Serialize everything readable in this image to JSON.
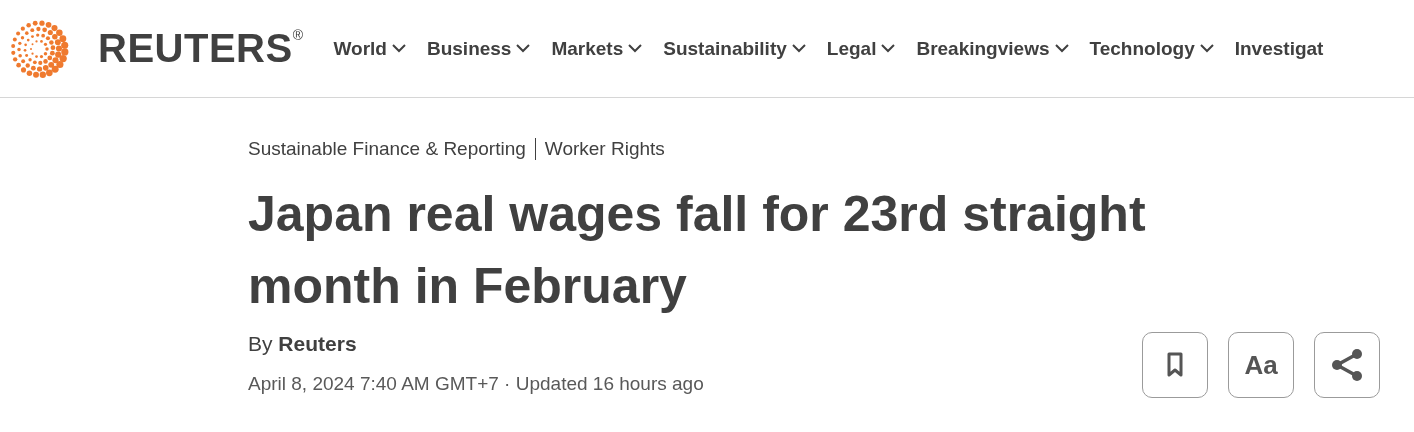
{
  "header": {
    "logo": "REUTERS$^{®}$",
    "nav": [
      {
        "label": "World",
        "has_menu": true
      },
      {
        "label": "Business",
        "has_menu": true
      },
      {
        "label": "Markets",
        "has_menu": true
      },
      {
        "label": "Sustainability",
        "has_menu": true
      },
      {
        "label": "Legal",
        "has_menu": true
      },
      {
        "label": "Breakingviews",
        "has_menu": true
      },
      {
        "label": "Technology",
        "has_menu": true
      },
      {
        "label": "Investigat",
        "has_menu": false
      }
    ]
  },
  "article": {
    "topics": [
      "Sustainable Finance & Reporting",
      "Worker Rights"
    ],
    "headline": "Japan real wages fall for 23rd straight month in February",
    "byline_prefix": "By",
    "author": "Reuters",
    "dateline": "April 8, 2024 7:40 AM GMT+7 · Updated 16 hours ago",
    "actions": [
      {
        "kind": "bookmark"
      },
      {
        "kind": "text",
        "label": "Aa"
      },
      {
        "kind": "share"
      }
    ]
  }
}
